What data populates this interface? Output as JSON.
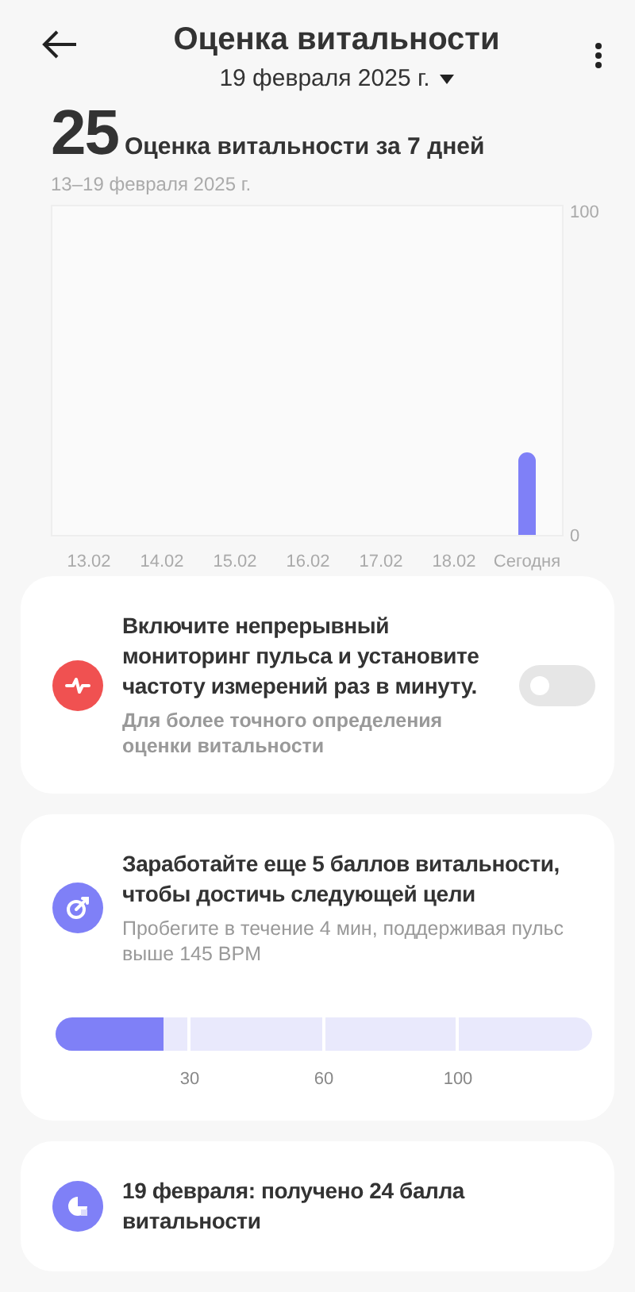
{
  "header": {
    "title": "Оценка витальности",
    "date": "19 февраля 2025 г."
  },
  "summary": {
    "score": "25",
    "label": "Оценка витальности за 7 дней",
    "range": "13–19 февраля 2025 г."
  },
  "chart_data": {
    "type": "bar",
    "categories": [
      "13.02",
      "14.02",
      "15.02",
      "16.02",
      "17.02",
      "18.02",
      "Сегодня"
    ],
    "series": [
      {
        "color": "#7f80f7",
        "values": [
          null,
          null,
          null,
          null,
          null,
          null,
          25
        ]
      }
    ],
    "ylim": [
      0,
      100
    ],
    "yticks": [
      0,
      100
    ]
  },
  "cards": [
    {
      "kind": "toggle",
      "color": "#f05151",
      "title": "Включите непрерывный мониторинг пульса и установите частоту измерений раз в минуту.",
      "subtitle": "Для более точного определения оценки витальности",
      "on": false
    },
    {
      "kind": "goal",
      "color": "#7f80f7",
      "title": "Заработайте еще 5 баллов витальности, чтобы достичь следующей цели",
      "subtitle": "Пробегите в течение 4 мин, поддерживая пульс выше 145 BPM",
      "level": 0.2,
      "ticks": [
        "30",
        "60",
        "100"
      ]
    },
    {
      "kind": "summary",
      "color": "#7f80f7",
      "title": "19 февраля: получено 24 балла витальности"
    }
  ]
}
